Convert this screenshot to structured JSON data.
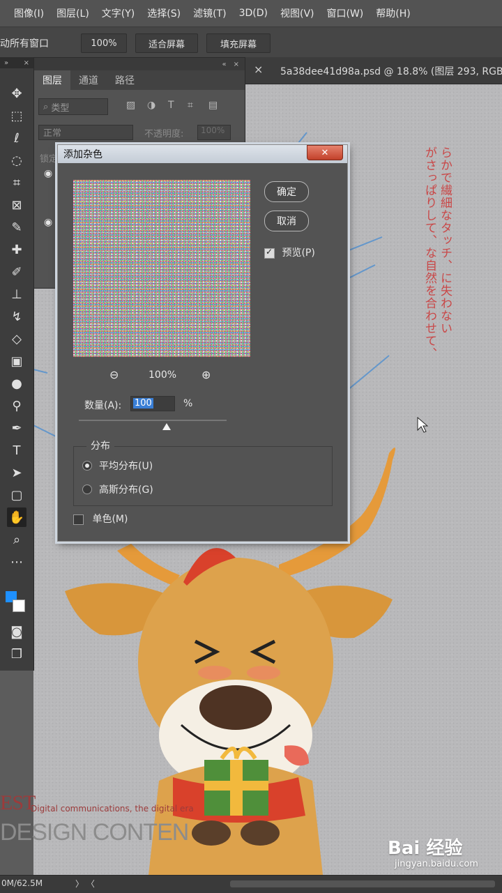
{
  "menu": [
    "图像(I)",
    "图层(L)",
    "文字(Y)",
    "选择(S)",
    "滤镜(T)",
    "3D(D)",
    "视图(V)",
    "窗口(W)",
    "帮助(H)"
  ],
  "options": {
    "label": "动所有窗口",
    "zoom": "100%",
    "fit_screen": "适合屏幕",
    "fill_screen": "填充屏幕"
  },
  "document": {
    "tab_title": "5a38dee41d98a.psd @ 18.8% (图层 293, RGB/8)",
    "close": "×"
  },
  "layers_panel": {
    "tabs": [
      "图层",
      "通道",
      "路径"
    ],
    "filter": "类型",
    "blend_mode": "正常",
    "opacity_label": "不透明度:",
    "opacity_value": "100%",
    "lock_label": "锁定"
  },
  "dialog": {
    "title": "添加杂色",
    "close": "✕",
    "ok": "确定",
    "cancel": "取消",
    "preview_label": "预览(P)",
    "preview_checked": true,
    "zoom": "100%",
    "amount_label": "数量(A):",
    "amount_value": "100",
    "amount_unit": "%",
    "distribution_label": "分布",
    "uniform_label": "平均分布(U)",
    "gaussian_label": "高斯分布(G)",
    "selected_distribution": "uniform",
    "monochromatic_label": "单色(M)",
    "monochromatic_checked": false
  },
  "artwork": {
    "japanese_lines": [
      "らかで繊細なタッチ、に失わない",
      "がさっぱりして、な自然を合わせて、"
    ],
    "poster_est": "EST",
    "poster_sub": "Digital communications, the digital era",
    "poster_design": "DESIGN CONTEN"
  },
  "status": {
    "text": "0M/62.5M",
    "arrows": "〉  〈"
  },
  "watermark": {
    "main": "Bai 经验",
    "url": "jingyan.baidu.com"
  },
  "colors": {
    "foreground": "#1e90ff",
    "background": "#ffffff"
  }
}
